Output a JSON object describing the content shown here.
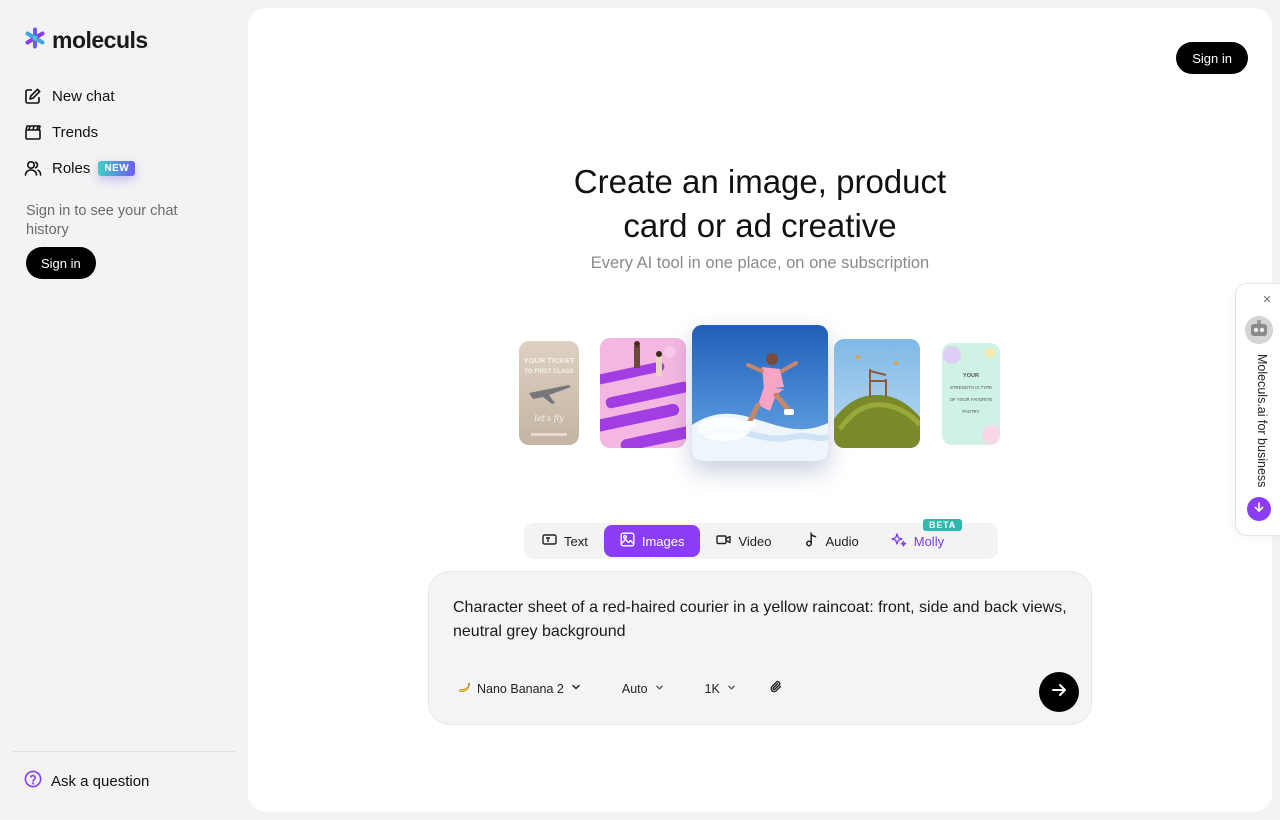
{
  "sidebar": {
    "brand": "moleculs",
    "nav": [
      {
        "label": "New chat",
        "icon": "edit-icon"
      },
      {
        "label": "Trends",
        "icon": "clapperboard-icon"
      },
      {
        "label": "Roles",
        "icon": "users-icon",
        "badge": "NEW"
      }
    ],
    "history_note": "Sign in to see your chat history",
    "sign_in": "Sign in",
    "ask": "Ask a question"
  },
  "header": {
    "sign_in": "Sign in"
  },
  "hero": {
    "title_line1": "Create an image, product",
    "title_line2": "card or ad creative",
    "subtitle": "Every AI tool in one place, on one subscription",
    "card_texts": {
      "ticket_line1": "YOUR TICKET",
      "ticket_line2": "TO FIRST CLASS",
      "ticket_script": "let's fly",
      "strength_line1": "YOUR",
      "strength_line2": "STRENGTH IS TYPE",
      "strength_line3": "OF YOUR FAVORITE",
      "strength_line4": "PASTRY"
    }
  },
  "tabs": [
    {
      "label": "Text",
      "icon": "text-icon",
      "active": false
    },
    {
      "label": "Images",
      "icon": "image-icon",
      "active": true
    },
    {
      "label": "Video",
      "icon": "video-icon",
      "active": false
    },
    {
      "label": "Audio",
      "icon": "music-note-icon",
      "active": false
    },
    {
      "label": "Molly",
      "icon": "sparkles-icon",
      "active": false,
      "badge": "BETA"
    }
  ],
  "prompt": {
    "text": "Character sheet of a red-haired courier in a yellow raincoat: front, side and back views, neutral grey background",
    "model": "Nano Banana 2",
    "aspect": "Auto",
    "resolution": "1K"
  },
  "business_panel": {
    "label": "Moleculs.ai for business"
  },
  "colors": {
    "accent": "#8b3df5",
    "teal": "#2fb8ad",
    "background": "#f3f3f3",
    "surface": "#ffffff"
  }
}
